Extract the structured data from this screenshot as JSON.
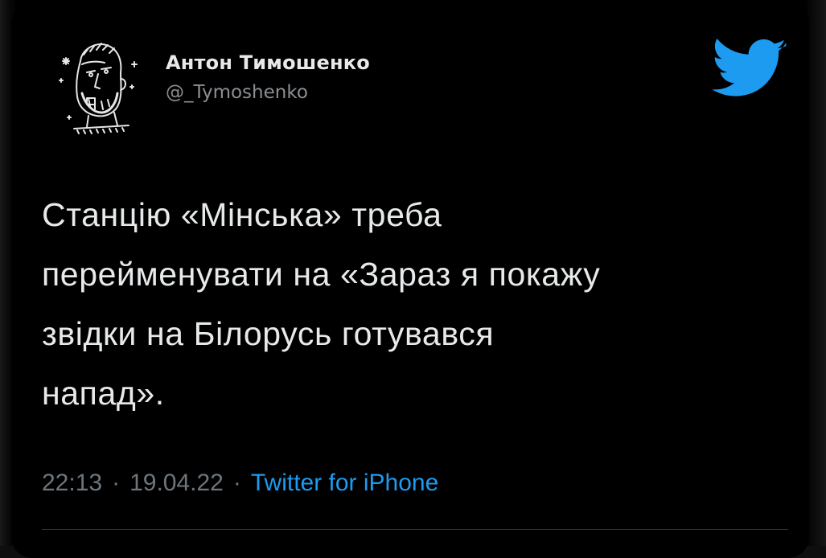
{
  "author": {
    "display_name": "Антон Тимошенко",
    "handle": "@_Tymoshenko",
    "avatar_icon": "sketch-portrait-avatar"
  },
  "logo_icon": "twitter-bird-icon",
  "colors": {
    "background": "#000000",
    "text": "#e7e9ea",
    "secondary": "#6e767d",
    "accent": "#1d9bf0"
  },
  "tweet": {
    "lines": [
      "Станцію «Мінська» треба",
      "перейменувати на «Зараз я покажу",
      "звідки на Білорусь готувався",
      "напад»."
    ]
  },
  "meta": {
    "time": "22:13",
    "separator": "·",
    "date": "19.04.22",
    "source": "Twitter for iPhone"
  }
}
